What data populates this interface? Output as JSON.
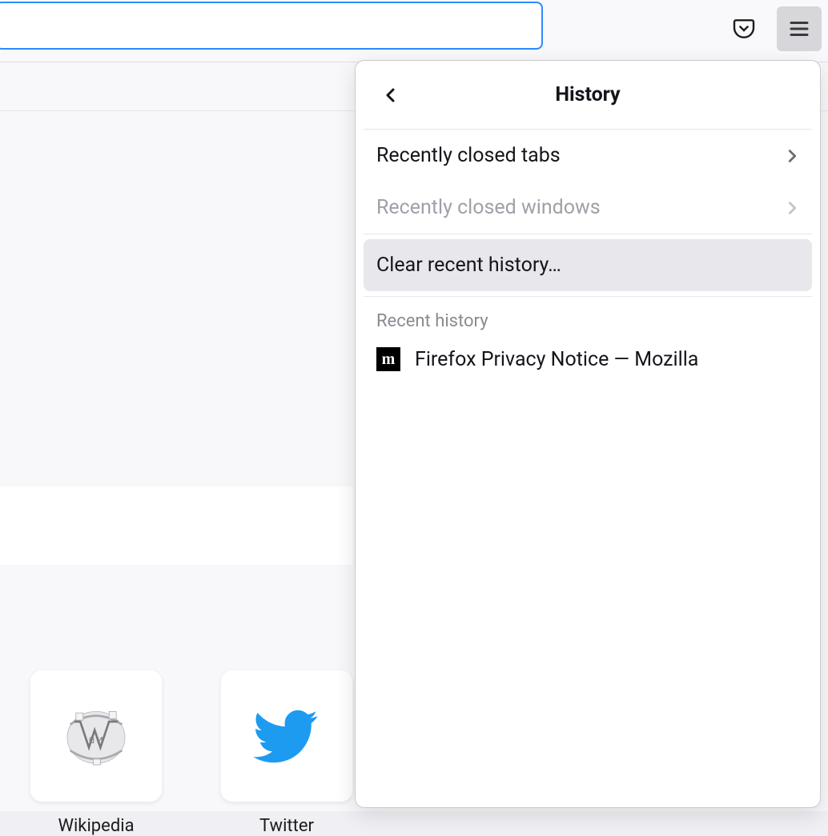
{
  "panel": {
    "title": "History",
    "recently_closed_tabs": "Recently closed tabs",
    "recently_closed_windows": "Recently closed windows",
    "clear_recent_history": "Clear recent history…",
    "recent_history_label": "Recent history",
    "items": [
      {
        "title": "Firefox Privacy Notice — Mozilla",
        "favicon": "m"
      }
    ]
  },
  "topsites": [
    {
      "label": "Wikipedia",
      "icon": "wikipedia"
    },
    {
      "label": "Twitter",
      "icon": "twitter"
    }
  ],
  "icons": {
    "pocket": "pocket-icon",
    "hamburger": "hamburger-icon",
    "back": "chevron-left-icon",
    "forward": "chevron-right-icon"
  }
}
